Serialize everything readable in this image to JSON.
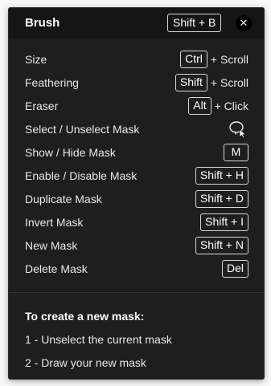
{
  "header": {
    "title": "Brush",
    "shortcut": "Shift + B",
    "close_label": "✕"
  },
  "shortcuts": [
    {
      "label": "Size",
      "key": "Ctrl",
      "suffix": "+ Scroll"
    },
    {
      "label": "Feathering",
      "key": "Shift",
      "suffix": "+ Scroll"
    },
    {
      "label": "Eraser",
      "key": "Alt",
      "suffix": "+ Click"
    },
    {
      "label": "Select / Unselect Mask",
      "icon": "lasso-cursor-icon"
    },
    {
      "label": "Show / Hide Mask",
      "key": "M"
    },
    {
      "label": "Enable / Disable Mask",
      "key": "Shift + H"
    },
    {
      "label": "Duplicate Mask",
      "key": "Shift + D"
    },
    {
      "label": "Invert Mask",
      "key": "Shift + I"
    },
    {
      "label": "New Mask",
      "key": "Shift + N"
    },
    {
      "label": "Delete Mask",
      "key": "Del"
    }
  ],
  "info": {
    "title": "To create a new mask:",
    "steps": [
      "1 - Unselect the current mask",
      "2 - Draw your new mask"
    ]
  },
  "colors": {
    "panel_bg": "#1e1e1e",
    "header_bg": "#151515",
    "text": "#e8e8e8",
    "key_border": "#d8d8d8"
  }
}
